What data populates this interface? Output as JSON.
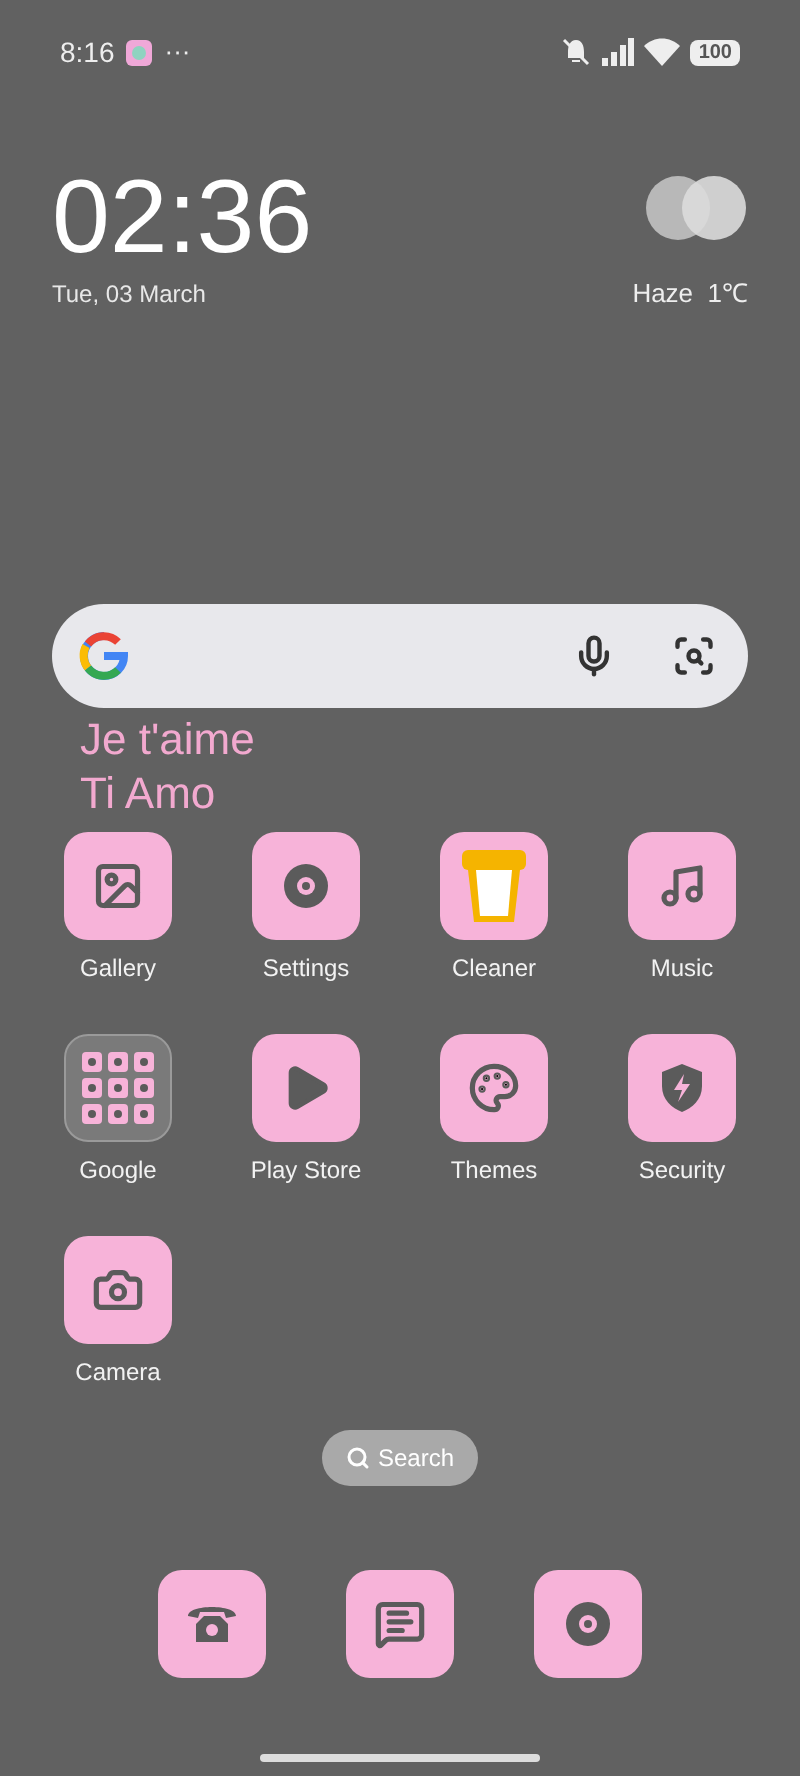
{
  "status_bar": {
    "time": "8:16",
    "more": "···",
    "battery": "100"
  },
  "clock": {
    "time": "02:36",
    "date": "Tue, 03 March"
  },
  "weather": {
    "condition": "Haze",
    "temperature": "1℃"
  },
  "widget": {
    "lines": [
      "Je t'aime",
      "Ti Amo"
    ]
  },
  "apps": [
    {
      "label": "Gallery",
      "kind": "gallery"
    },
    {
      "label": "Settings",
      "kind": "settings"
    },
    {
      "label": "Cleaner",
      "kind": "cleaner"
    },
    {
      "label": "Music",
      "kind": "music"
    },
    {
      "label": "Google",
      "kind": "folder"
    },
    {
      "label": "Play Store",
      "kind": "play"
    },
    {
      "label": "Themes",
      "kind": "themes"
    },
    {
      "label": "Security",
      "kind": "security"
    },
    {
      "label": "Camera",
      "kind": "camera"
    }
  ],
  "search_pill": {
    "label": "Search"
  },
  "dock": [
    {
      "kind": "phone"
    },
    {
      "kind": "messages"
    },
    {
      "kind": "settings"
    }
  ]
}
